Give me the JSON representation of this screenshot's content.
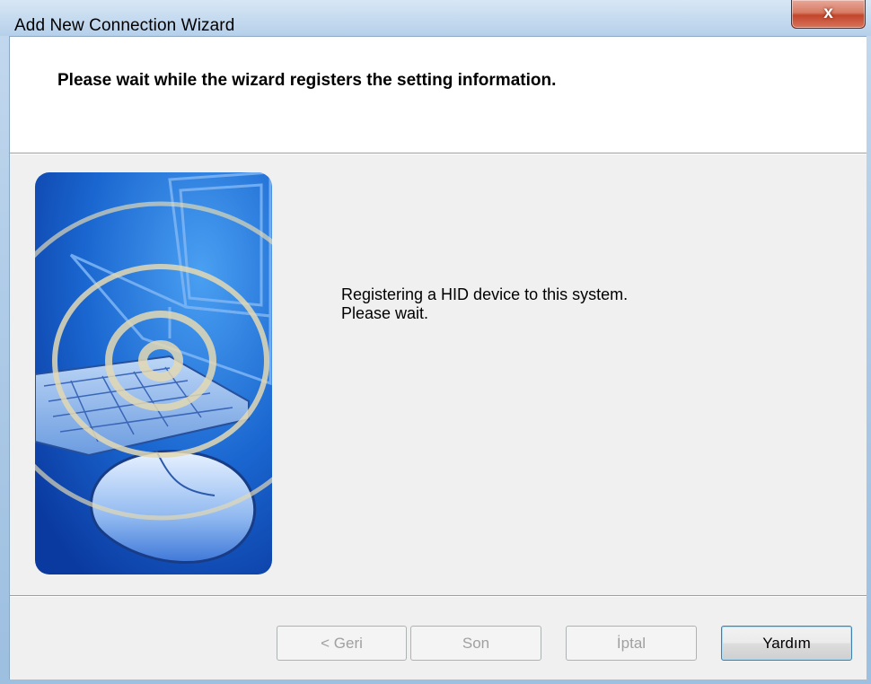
{
  "window": {
    "title": "Add New Connection Wizard",
    "close_glyph": "x"
  },
  "header": {
    "title": "Please wait while the wizard registers the setting information."
  },
  "body": {
    "message_line1": "Registering a HID device to this system.",
    "message_line2": "Please wait."
  },
  "illustration": {
    "subject": "laptop, keyboard and mouse with wireless signal rings"
  },
  "buttons": {
    "back": {
      "label": "< Geri",
      "enabled": false
    },
    "finish": {
      "label": "Son",
      "enabled": false
    },
    "cancel": {
      "label": "İptal",
      "enabled": false
    },
    "help": {
      "label": "Yardım",
      "enabled": true
    }
  },
  "colors": {
    "art_blue_light": "#3a8ee8",
    "art_blue_dark": "#0b3fa8",
    "ring_color": "#e3d9b4",
    "dialog_bg": "#f0f0f0"
  }
}
